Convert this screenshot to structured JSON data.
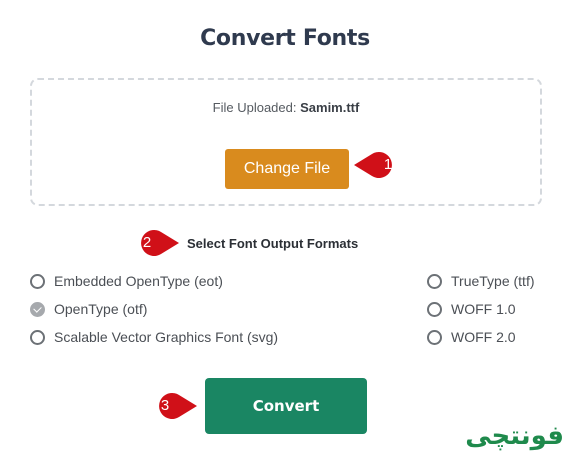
{
  "page": {
    "title": "Convert Fonts"
  },
  "upload": {
    "status_prefix": "File Uploaded: ",
    "file_name": "Samim.ttf",
    "change_button": "Change File"
  },
  "formats": {
    "label": "Select Font Output Formats",
    "left": [
      {
        "label": "Embedded OpenType (eot)",
        "checked": false
      },
      {
        "label": "OpenType (otf)",
        "checked": true
      },
      {
        "label": "Scalable Vector Graphics Font (svg)",
        "checked": false
      }
    ],
    "right": [
      {
        "label": "TrueType (ttf)",
        "checked": false
      },
      {
        "label": "WOFF 1.0",
        "checked": false
      },
      {
        "label": "WOFF 2.0",
        "checked": false
      }
    ]
  },
  "actions": {
    "convert_button": "Convert"
  },
  "markers": {
    "m1": "1",
    "m2": "2",
    "m3": "3"
  },
  "brand": {
    "logo_text": "فونتچی"
  },
  "colors": {
    "change_button": "#d98b1e",
    "convert_button": "#1a8663",
    "marker": "#d01018",
    "brand": "#1f8a4c"
  }
}
